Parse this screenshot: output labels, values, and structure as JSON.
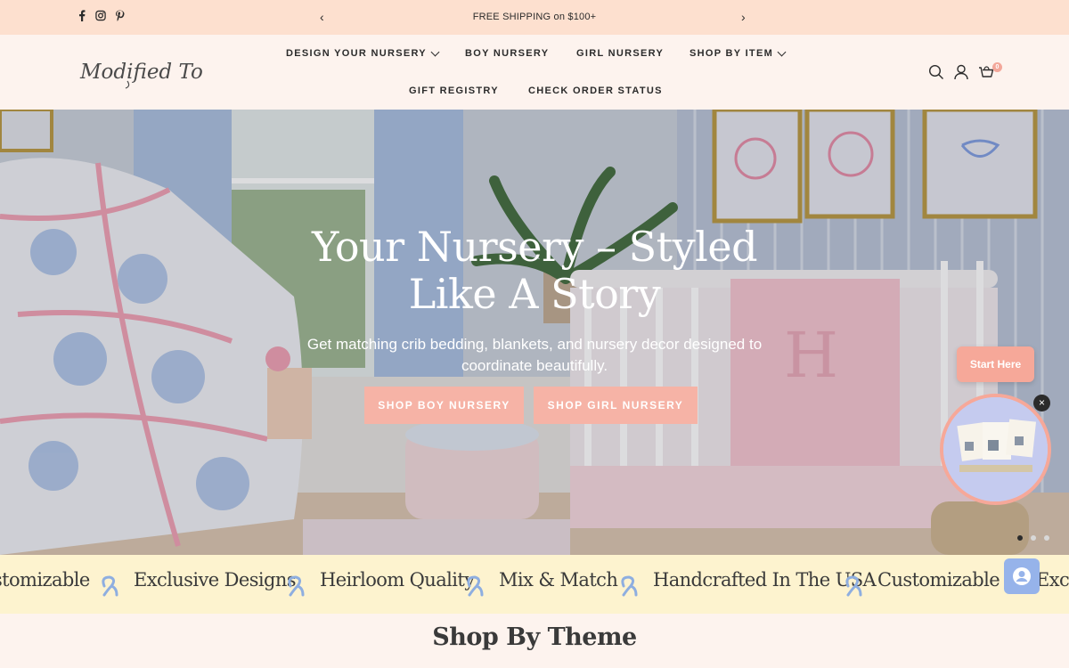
{
  "announcement": {
    "text": "FREE SHIPPING on $100+",
    "prev": "‹",
    "next": "›",
    "social_icons": [
      "facebook-icon",
      "instagram-icon",
      "pinterest-icon"
    ]
  },
  "header": {
    "logo_text": "Modified Tot",
    "nav": [
      {
        "label": "DESIGN YOUR NURSERY",
        "dropdown": true
      },
      {
        "label": "BOY NURSERY",
        "dropdown": false
      },
      {
        "label": "GIRL NURSERY",
        "dropdown": false
      },
      {
        "label": "SHOP BY ITEM",
        "dropdown": true
      },
      {
        "label": "GIFT REGISTRY",
        "dropdown": false
      },
      {
        "label": "CHECK ORDER STATUS",
        "dropdown": false
      }
    ],
    "icons": [
      "search-icon",
      "account-icon",
      "cart-icon"
    ],
    "cart_count": "0"
  },
  "hero": {
    "title": "Your Nursery – Styled Like A Story",
    "subtitle": "Get matching crib bedding, blankets, and nursery decor designed to coordinate beautifully.",
    "buttons": [
      "SHOP BOY NURSERY",
      "SHOP GIRL NURSERY"
    ],
    "slides": 3,
    "active_slide": 1
  },
  "widget": {
    "start_label": "Start Here",
    "close": "×"
  },
  "marquee": {
    "items": [
      "stomizable",
      "Exclusive Designs",
      "Heirloom Quality",
      "Mix & Match",
      "Handcrafted In The USA",
      "Customizable",
      "Exclu"
    ]
  },
  "section": {
    "title": "Shop By Theme"
  },
  "colors": {
    "announcement_bg": "#fde0cf",
    "page_bg": "#fdf3ee",
    "accent": "#f6b3a6",
    "marquee_bg": "#fdf3cf",
    "chat_bg": "#96b3ea"
  }
}
